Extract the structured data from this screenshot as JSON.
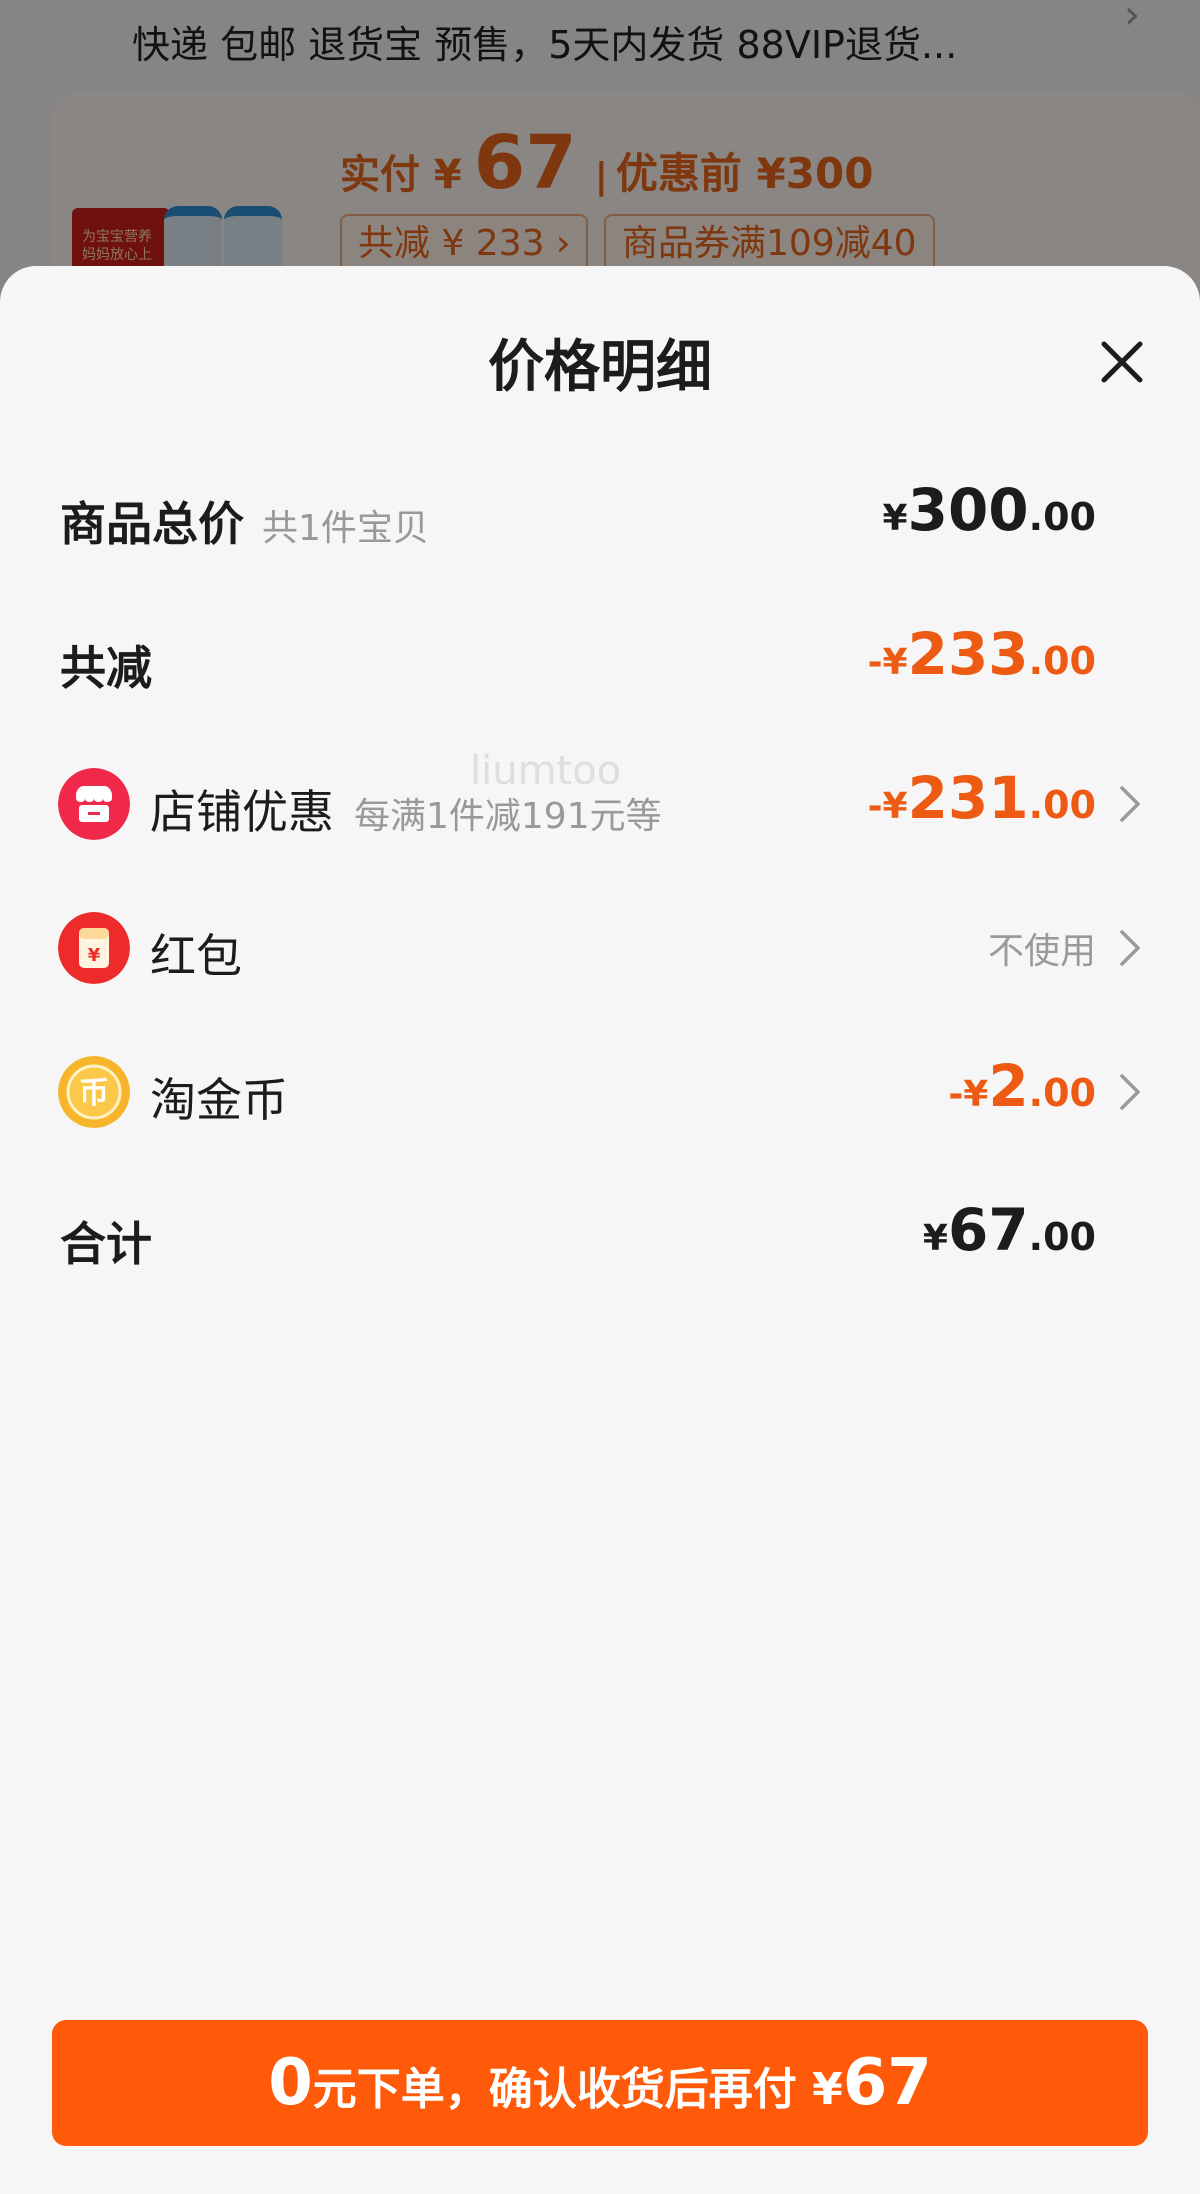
{
  "background": {
    "services": "快递 包邮 退货宝 预售，5天内发货 88VIP退货...",
    "price_label": "实付 ¥",
    "price_value": "67",
    "price_before": "优惠前 ¥300",
    "tag_total_reduction": "共减 ¥ 233 ›",
    "tag_coupon": "商品券满109减40",
    "product_image_text": "为宝宝营养 妈妈放心上"
  },
  "sheet": {
    "title": "价格明细",
    "goods_total": {
      "label": "商品总价",
      "sub": "共1件宝贝",
      "currency": "¥",
      "int": "300",
      "dec": ".00"
    },
    "total_reduction": {
      "label": "共减",
      "currency": "-¥",
      "int": "233",
      "dec": ".00"
    },
    "store_discount": {
      "label": "店铺优惠",
      "sub": "每满1件减191元等",
      "currency": "-¥",
      "int": "231",
      "dec": ".00"
    },
    "red_packet": {
      "label": "红包",
      "status": "不使用",
      "icon_glyph": "¥"
    },
    "taojinbi": {
      "label": "淘金币",
      "currency": "-¥",
      "int": "2",
      "dec": ".00",
      "icon_glyph": "币"
    },
    "sum": {
      "label": "合计",
      "currency": "¥",
      "int": "67",
      "dec": ".00"
    },
    "watermark": "liumtoo"
  },
  "confirm": {
    "zero": "0",
    "text": "元下单，确认收货后再付 ¥",
    "amount": "67"
  },
  "colors": {
    "accent_orange": "#ec5a13",
    "button_orange": "#fe5a09",
    "store_icon_bg": "#f0284a",
    "red_packet_bg": "#ee2b2b",
    "coin_bg": "#f7b52b"
  }
}
